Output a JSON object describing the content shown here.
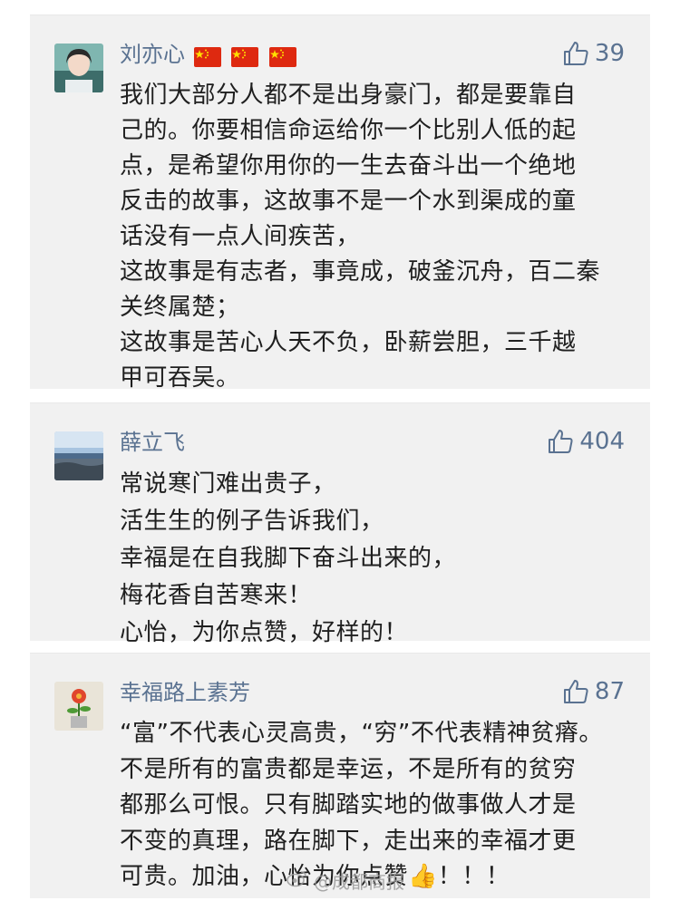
{
  "comments": [
    {
      "username": "刘亦心",
      "flags": [
        "cn-flag-icon",
        "cn-flag-icon",
        "cn-flag-icon"
      ],
      "likes": "39",
      "lines": [
        "我们大部分人都不是出身豪门，都是要靠自",
        "己的。你要相信命运给你一个比别人低的起",
        "点，是希望你用你的一生去奋斗出一个绝地",
        "反击的故事，这故事不是一个水到渠成的童",
        "话没有一点人间疾苦，",
        "这故事是有志者，事竟成，破釜沉舟，百二秦",
        "关终属楚；",
        "这故事是苦心人天不负，卧薪尝胆，三千越",
        "甲可吞吴。"
      ]
    },
    {
      "username": "薛立飞",
      "likes": "404",
      "lines": [
        "常说寒门难出贵子，",
        "活生生的例子告诉我们，",
        "幸福是在自我脚下奋斗出来的，",
        "梅花香自苦寒来！",
        "心怡，为你点赞，好样的！"
      ]
    },
    {
      "username": "幸福路上素芳",
      "likes": "87",
      "lines": [
        "“富”不代表心灵高贵，“穷”不代表精神贫瘠。",
        "不是所有的富贵都是幸运，不是所有的贫穷",
        "都那么可恨。只有脚踏实地的做事做人才是",
        "不变的真理，路在脚下，走出来的幸福才更",
        "可贵。加油，心怡为你点赞👍！！！"
      ]
    }
  ],
  "watermark": "@成都商报",
  "colors": {
    "username": "#5a7291",
    "card_bg": "#f1f1f1",
    "text": "#1f1f1f"
  }
}
